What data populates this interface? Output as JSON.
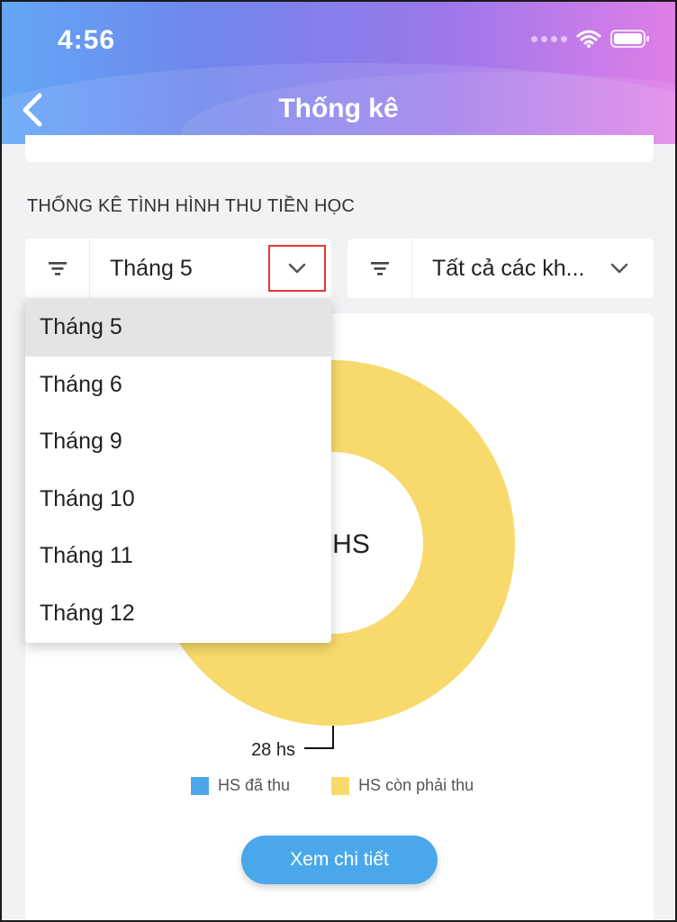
{
  "status_bar": {
    "time": "4:56"
  },
  "header": {
    "title": "Thống kê"
  },
  "section": {
    "title": "THỐNG KÊ TÌNH HÌNH THU TIỀN HỌC"
  },
  "filters": {
    "month": {
      "value": "Tháng 5",
      "icon": "filter-icon"
    },
    "grade": {
      "value": "Tất cả các kh...",
      "icon": "filter-icon"
    }
  },
  "dropdown": {
    "options": [
      "Tháng 5",
      "Tháng 6",
      "Tháng 9",
      "Tháng 10",
      "Tháng 11",
      "Tháng 12"
    ],
    "selected": "Tháng 5"
  },
  "chart": {
    "center_label": "HS",
    "callout_label": "28 hs",
    "legend": [
      {
        "label": "HS đã thu",
        "color": "#4aa8ea"
      },
      {
        "label": "HS còn phải thu",
        "color": "#f7da6b"
      }
    ]
  },
  "chart_data": {
    "type": "pie",
    "categories": [
      "HS đã thu",
      "HS còn phải thu"
    ],
    "values": [
      0,
      28
    ],
    "colors": [
      "#4aa8ea",
      "#f7da6b"
    ],
    "legend_position": "bottom"
  },
  "actions": {
    "detail_label": "Xem chi tiết"
  },
  "colors": {
    "accent": "#4aa8ea",
    "highlight": "#e53935"
  }
}
